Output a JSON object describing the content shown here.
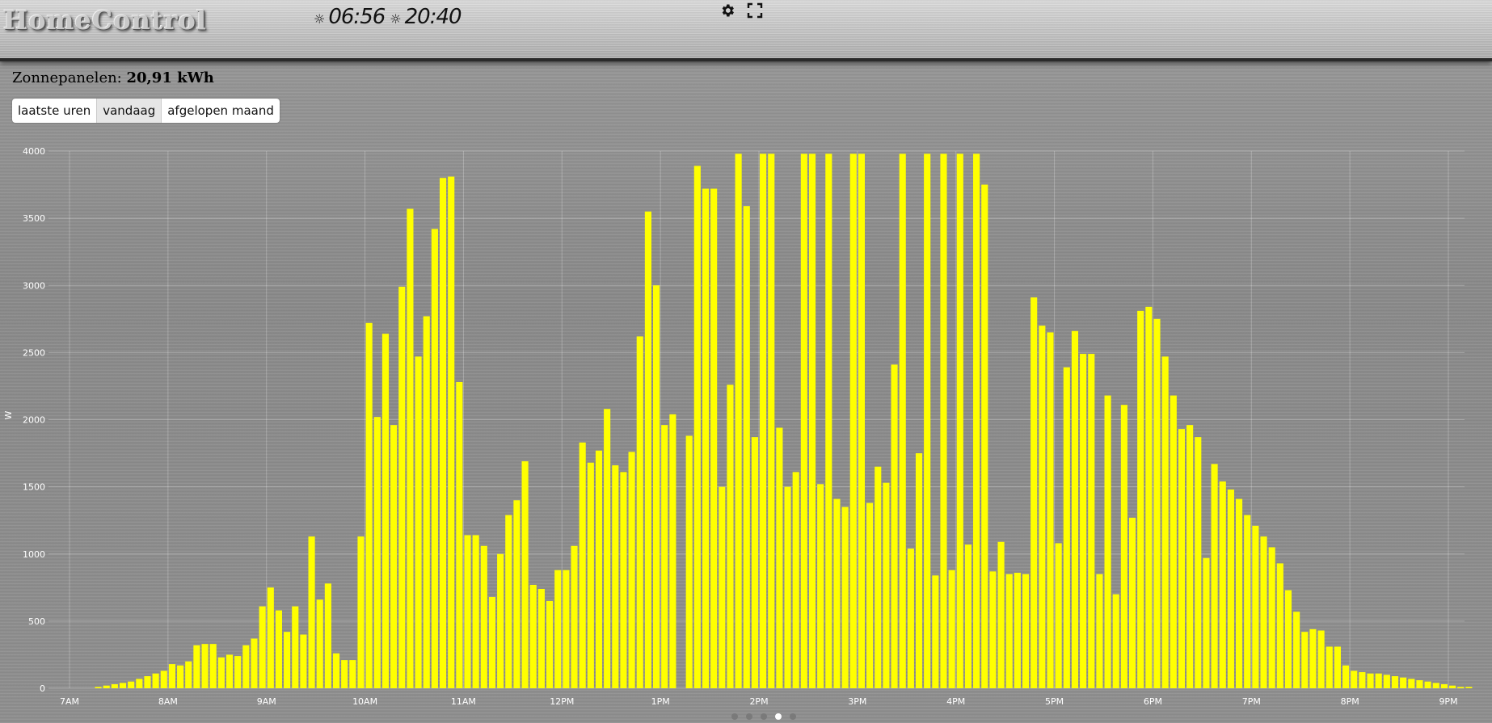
{
  "app": {
    "logo": "HomeControl"
  },
  "sun": {
    "rise_icon": "sunrise-icon",
    "sunrise": "06:56",
    "set_icon": "sunset-icon",
    "sunset": "20:40"
  },
  "toolbar": {
    "settings_icon": "gear-icon",
    "fullscreen_icon": "fullscreen-icon"
  },
  "panel": {
    "title_label": "Zonnepanelen:",
    "title_value": "20,91 kWh"
  },
  "tabs": [
    {
      "label": "laatste uren",
      "active": false
    },
    {
      "label": "vandaag",
      "active": true
    },
    {
      "label": "afgelopen maand",
      "active": false
    }
  ],
  "pager": {
    "count": 5,
    "active_index": 3
  },
  "chart_data": {
    "type": "bar",
    "xlabel": "",
    "ylabel": "W",
    "ylim": [
      0,
      4000
    ],
    "yticks": [
      "0",
      "500",
      "1000",
      "1500",
      "2000",
      "2500",
      "3000",
      "3500",
      "4000"
    ],
    "xticks": [
      "7AM",
      "8AM",
      "9AM",
      "10AM",
      "11AM",
      "12PM",
      "1PM",
      "2PM",
      "3PM",
      "4PM",
      "5PM",
      "6PM",
      "7PM",
      "8PM",
      "9PM"
    ],
    "bar_color": "#ffff00",
    "grid": true,
    "start_hour": 7,
    "interval_minutes": 5,
    "first_bar_index": 3,
    "series": [
      {
        "values": [
          10,
          20,
          30,
          40,
          50,
          70,
          90,
          110,
          130,
          180,
          170,
          200,
          320,
          330,
          330,
          230,
          250,
          240,
          320,
          370,
          610,
          750,
          580,
          420,
          610,
          400,
          1130,
          660,
          780,
          260,
          210,
          210,
          1130,
          2720,
          2020,
          2640,
          1960,
          2990,
          3570,
          2470,
          2770,
          3420,
          3800,
          3810,
          2280,
          1140,
          1140,
          1060,
          680,
          1000,
          1290,
          1400,
          1690,
          770,
          740,
          650,
          880,
          880,
          1060,
          1830,
          1680,
          1770,
          2080,
          1660,
          1610,
          1760,
          2620,
          3550,
          3000,
          1960,
          2040,
          0,
          1880,
          3890,
          3720,
          3720,
          1500,
          2260,
          3980,
          3590,
          1870,
          3980,
          3980,
          1940,
          1500,
          1610,
          3980,
          3980,
          1520,
          3980,
          1410,
          1350,
          3980,
          3980,
          1380,
          1650,
          1530,
          2410,
          3980,
          1040,
          1750,
          3980,
          840,
          3980,
          880,
          3980,
          1070,
          3980,
          3750,
          870,
          1090,
          850,
          860,
          850,
          2910,
          2700,
          2650,
          1080,
          2390,
          2660,
          2490,
          2490,
          850,
          2180,
          700,
          2110,
          1270,
          2810,
          2840,
          2750,
          2470,
          2180,
          1930,
          1960,
          1870,
          970,
          1670,
          1540,
          1480,
          1410,
          1290,
          1210,
          1130,
          1050,
          930,
          730,
          570,
          420,
          440,
          430,
          310,
          310,
          170,
          130,
          120,
          110,
          110,
          100,
          90,
          80,
          70,
          60,
          50,
          40,
          30,
          20,
          10,
          10
        ]
      }
    ]
  }
}
